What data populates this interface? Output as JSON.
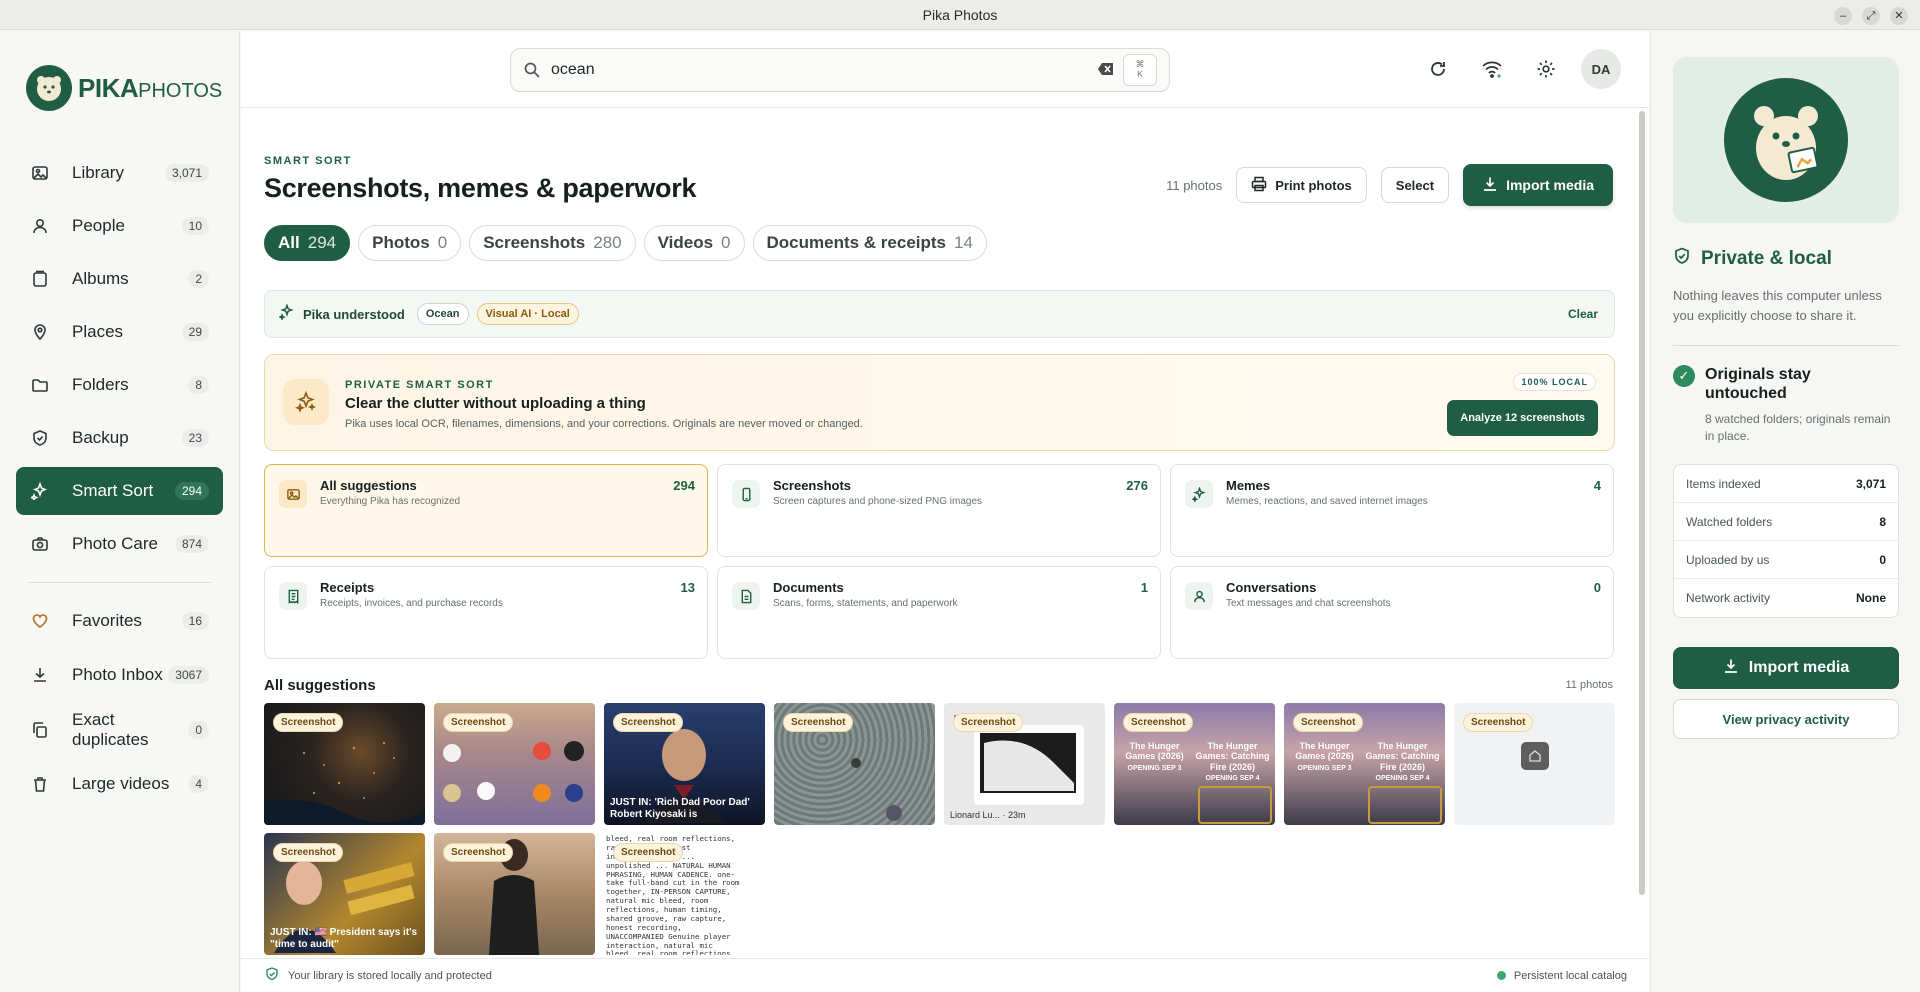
{
  "window": {
    "title": "Pika Photos",
    "controls": [
      "minimize-icon",
      "maximize-icon",
      "close-icon"
    ]
  },
  "brand": {
    "name_bold": "PIKA",
    "name_light": "PHOTOS",
    "color": "#1f5e44"
  },
  "sidebar": {
    "items": [
      {
        "label": "Library",
        "count": "3,071",
        "icon": "image-icon"
      },
      {
        "label": "People",
        "count": "10",
        "icon": "person-icon"
      },
      {
        "label": "Albums",
        "count": "2",
        "icon": "album-icon"
      },
      {
        "label": "Places",
        "count": "29",
        "icon": "map-pin-icon"
      },
      {
        "label": "Folders",
        "count": "8",
        "icon": "folder-icon"
      },
      {
        "label": "Backup",
        "count": "23",
        "icon": "shield-icon"
      },
      {
        "label": "Smart Sort",
        "count": "294",
        "icon": "sparkle-icon",
        "active": true
      },
      {
        "label": "Photo Care",
        "count": "874",
        "icon": "camera-icon"
      }
    ],
    "secondary": [
      {
        "label": "Favorites",
        "count": "16",
        "icon": "heart-icon"
      },
      {
        "label": "Photo Inbox",
        "count": "3067",
        "icon": "download-icon"
      },
      {
        "label": "Exact duplicates",
        "count": "0",
        "icon": "copy-icon"
      },
      {
        "label": "Large videos",
        "count": "4",
        "icon": "trash-icon"
      }
    ]
  },
  "search": {
    "value": "ocean",
    "shortcut_top": "⌘",
    "shortcut_bottom": "K"
  },
  "user": {
    "initials": "DA"
  },
  "header": {
    "eyebrow": "SMART SORT",
    "title": "Screenshots, memes & paperwork",
    "photo_count": "11 photos",
    "print_label": "Print photos",
    "select_label": "Select",
    "import_label": "Import media"
  },
  "tabs": [
    {
      "label": "All",
      "count": "294",
      "active": true
    },
    {
      "label": "Photos",
      "count": "0"
    },
    {
      "label": "Screenshots",
      "count": "280"
    },
    {
      "label": "Videos",
      "count": "0"
    },
    {
      "label": "Documents & receipts",
      "count": "14"
    }
  ],
  "understood": {
    "label": "Pika understood",
    "chips": [
      "Ocean",
      "Visual AI · Local"
    ],
    "clear_label": "Clear"
  },
  "banner": {
    "eyebrow": "PRIVATE SMART SORT",
    "title": "Clear the clutter without uploading a thing",
    "description": "Pika uses local OCR, filenames, dimensions, and your corrections. Originals are never moved or changed.",
    "badge": "100% LOCAL",
    "button": "Analyze 12 screenshots"
  },
  "categories": [
    {
      "title": "All suggestions",
      "desc": "Everything Pika has recognized",
      "count": "294",
      "icon": "image-icon",
      "selected": true
    },
    {
      "title": "Screenshots",
      "desc": "Screen captures and phone-sized PNG images",
      "count": "276",
      "icon": "phone-icon"
    },
    {
      "title": "Memes",
      "desc": "Memes, reactions, and saved internet images",
      "count": "4",
      "icon": "sparkle-icon"
    },
    {
      "title": "Receipts",
      "desc": "Receipts, invoices, and purchase records",
      "count": "13",
      "icon": "receipt-icon"
    },
    {
      "title": "Documents",
      "desc": "Scans, forms, statements, and paperwork",
      "count": "1",
      "icon": "document-icon"
    },
    {
      "title": "Conversations",
      "desc": "Text messages and chat screenshots",
      "count": "0",
      "icon": "person-icon"
    }
  ],
  "grid": {
    "title": "All suggestions",
    "count": "11 photos",
    "badge": "Screenshot",
    "thumbs": [
      {
        "caption": ""
      },
      {
        "caption": ""
      },
      {
        "caption": "JUST IN: 'Rich Dad Poor Dad' Robert Kiyosaki is"
      },
      {
        "caption": ""
      },
      {
        "caption": "Lionard Lu... · 23m"
      },
      {
        "caption_a": "The Hunger Games (2026)",
        "caption_b": "The Hunger Games: Catching Fire (2026)",
        "sub_a": "OPENING SEP 3",
        "sub_b": "OPENING SEP 4"
      },
      {
        "caption_a": "The Hunger Games (2026)",
        "caption_b": "The Hunger Games: Catching Fire (2026)",
        "sub_a": "OPENING SEP 3",
        "sub_b": "OPENING SEP 4"
      },
      {
        "caption": ""
      },
      {
        "caption": "JUST IN: 🇺🇸 President says it's \"time to audit\""
      },
      {
        "caption": ""
      },
      {
        "caption": "bleed, real room reflections, raw capture, honest interaction, raw ... unpolished ... NATURAL HUMAN PHRASING, HUMAN CADENCE. one-take full-band cut in the room together, IN-PERSON CAPTURE, natural mic bleed, room reflections, human timing, shared groove, raw capture, honest recording, UNACCOMPANIED Genuine player interaction, natural mic bleed, real room reflections, unpolished recording in a large room. Real"
      }
    ]
  },
  "footer": {
    "left": "Your library is stored locally and protected",
    "right": "Persistent local catalog"
  },
  "panel": {
    "title": "Private & local",
    "desc": "Nothing leaves this computer unless you explicitly choose to share it.",
    "check_title": "Originals stay untouched",
    "check_desc": "8 watched folders; originals remain in place.",
    "stats": [
      {
        "label": "Items indexed",
        "value": "3,071"
      },
      {
        "label": "Watched folders",
        "value": "8"
      },
      {
        "label": "Uploaded by us",
        "value": "0"
      },
      {
        "label": "Network activity",
        "value": "None"
      }
    ],
    "import_label": "Import media",
    "privacy_label": "View privacy activity"
  }
}
